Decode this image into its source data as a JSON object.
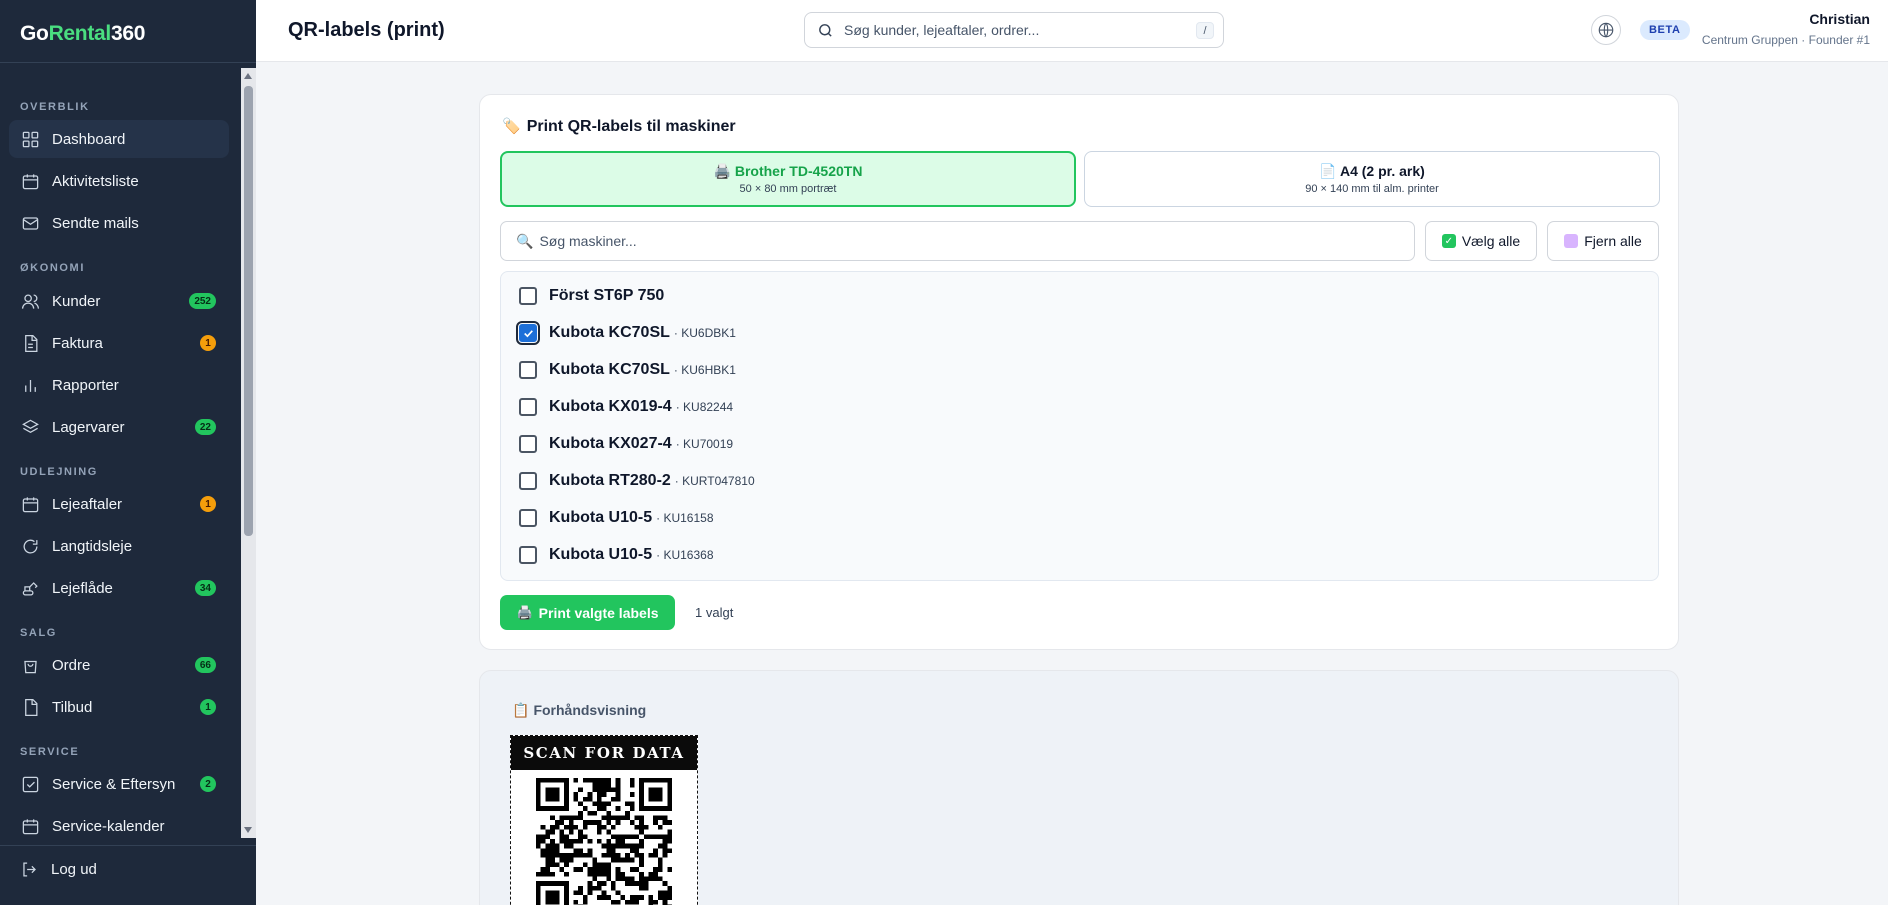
{
  "app": {
    "logo_part1": "Go",
    "logo_part2": "Rental",
    "logo_part3": "360"
  },
  "sidebar": {
    "sections": [
      "OVERBLIK",
      "ØKONOMI",
      "UDLEJNING",
      "SALG",
      "SERVICE"
    ],
    "items": [
      {
        "label": "Dashboard",
        "icon": "dashboard-icon"
      },
      {
        "label": "Aktivitetsliste",
        "icon": "calendar-icon"
      },
      {
        "label": "Sendte mails",
        "icon": "mail-icon"
      },
      {
        "label": "Kunder",
        "icon": "users-icon",
        "badge": "252"
      },
      {
        "label": "Faktura",
        "icon": "invoice-icon",
        "badge": "1"
      },
      {
        "label": "Rapporter",
        "icon": "bar-chart-icon"
      },
      {
        "label": "Lagervarer",
        "icon": "layers-icon",
        "badge": "22"
      },
      {
        "label": "Lejeaftaler",
        "icon": "calendar-icon",
        "badge": "1"
      },
      {
        "label": "Langtidsleje",
        "icon": "refresh-icon"
      },
      {
        "label": "Lejeflåde",
        "icon": "excavator-icon",
        "badge": "34"
      },
      {
        "label": "Ordre",
        "icon": "shopping-bag-icon",
        "badge": "66"
      },
      {
        "label": "Tilbud",
        "icon": "document-icon",
        "badge": "1"
      },
      {
        "label": "Service & Eftersyn",
        "icon": "checklist-icon",
        "badge": "2"
      },
      {
        "label": "Service-kalender",
        "icon": "calendar-icon"
      }
    ],
    "logout": "Log ud"
  },
  "header": {
    "title": "QR-labels (print)",
    "search_placeholder": "Søg kunder, lejeaftaler, ordrer...",
    "search_shortcut": "/",
    "beta": "BETA",
    "user_name": "Christian",
    "user_sub": "Centrum Gruppen · Founder #1"
  },
  "print_card": {
    "title": "Print QR-labels til maskiner",
    "title_emoji": "🏷️",
    "formats": [
      {
        "emoji": "🖨️",
        "title": "Brother TD-4520TN",
        "subtitle": "50 × 80 mm portræt",
        "selected": true
      },
      {
        "emoji": "📄",
        "title": "A4 (2 pr. ark)",
        "subtitle": "90 × 140 mm til alm. printer",
        "selected": false
      }
    ],
    "search_emoji": "🔍",
    "search_placeholder": "Søg maskiner...",
    "select_all": "Vælg alle",
    "remove_all": "Fjern alle",
    "machines": [
      {
        "name": "Först ST6P 750",
        "code": "",
        "checked": false
      },
      {
        "name": "Kubota KC70SL",
        "code": "· KU6DBK1",
        "checked": true
      },
      {
        "name": "Kubota KC70SL",
        "code": "· KU6HBK1",
        "checked": false
      },
      {
        "name": "Kubota KX019-4",
        "code": "· KU82244",
        "checked": false
      },
      {
        "name": "Kubota KX027-4",
        "code": "· KU70019",
        "checked": false
      },
      {
        "name": "Kubota RT280-2",
        "code": "· KURT047810",
        "checked": false
      },
      {
        "name": "Kubota U10-5",
        "code": "· KU16158",
        "checked": false
      },
      {
        "name": "Kubota U10-5",
        "code": "· KU16368",
        "checked": false
      }
    ],
    "print_button": "Print valgte labels",
    "print_emoji": "🖨️",
    "selected_count": "1 valgt"
  },
  "preview": {
    "title": "Forhåndsvisning",
    "title_emoji": "📋",
    "label_header": "SCAN FOR DATA"
  },
  "colors": {
    "accent": "#22c55e",
    "sidebar_bg": "#1e293b",
    "checkbox_blue": "#1d6fd8"
  }
}
